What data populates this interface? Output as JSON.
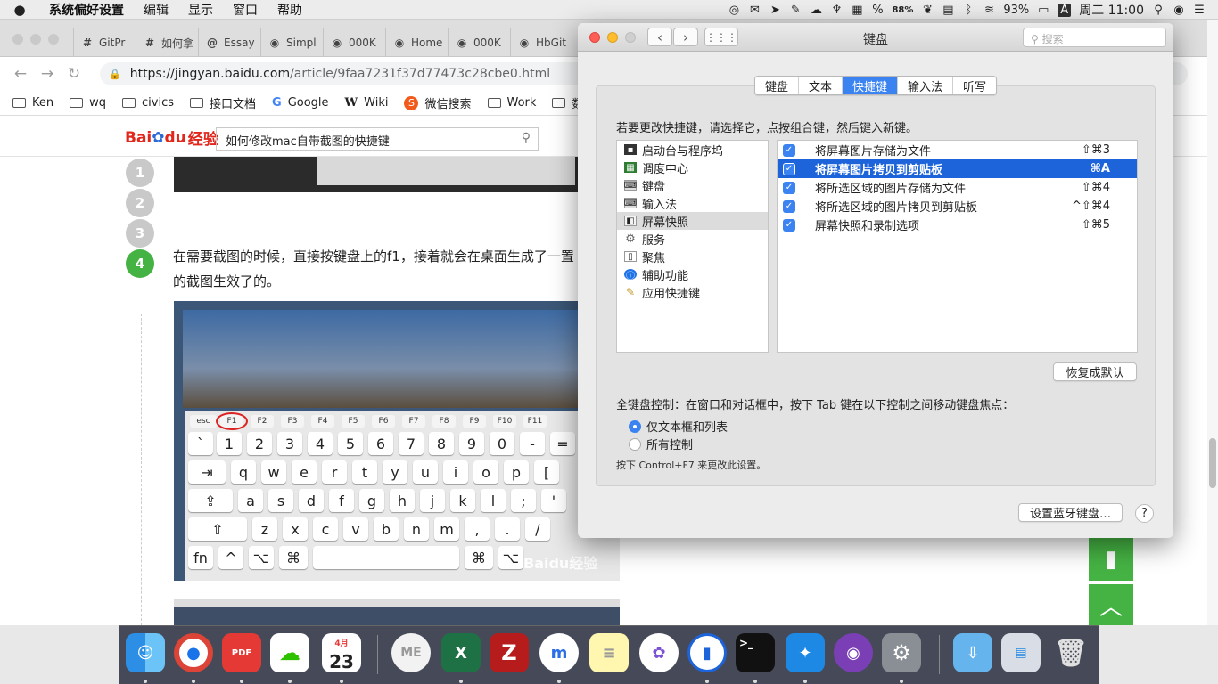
{
  "menubar": {
    "apple": "",
    "app": "系统偏好设置",
    "items": [
      "编辑",
      "显示",
      "窗口",
      "帮助"
    ],
    "battery_small": "88%",
    "battery": "93%",
    "input_method": "A",
    "clock": "周二 11:00"
  },
  "browser": {
    "tabs": [
      {
        "icon": "#",
        "label": "GitPr"
      },
      {
        "icon": "#",
        "label": "如何拿"
      },
      {
        "icon": "@",
        "label": "Essay"
      },
      {
        "icon": "◉",
        "label": "Simpl"
      },
      {
        "icon": "◉",
        "label": "000K"
      },
      {
        "icon": "◉",
        "label": "Home"
      },
      {
        "icon": "◉",
        "label": "000K"
      },
      {
        "icon": "◉",
        "label": "HbGit"
      }
    ],
    "url_main": "https://jingyan.baidu.com",
    "url_path": "/article/9faa7231f37d77473c28cbe0.html",
    "bookmarks": [
      {
        "icon": "folder",
        "label": "Ken"
      },
      {
        "icon": "folder",
        "label": "wq"
      },
      {
        "icon": "folder",
        "label": "civics"
      },
      {
        "icon": "folder",
        "label": "接口文档"
      },
      {
        "icon": "G",
        "label": "Google"
      },
      {
        "icon": "W",
        "label": "Wiki"
      },
      {
        "icon": "S",
        "label": "微信搜索"
      },
      {
        "icon": "folder",
        "label": "Work"
      },
      {
        "icon": "folder",
        "label": "数据"
      }
    ]
  },
  "baidu": {
    "logo_a": "Bai",
    "logo_b": "du",
    "logo_c": "经验",
    "search_value": "如何修改mac自带截图的快捷键"
  },
  "article": {
    "steps": [
      "1",
      "2",
      "3",
      "4"
    ],
    "paragraph": "在需要截图的时候，直接按键盘上的f1，接着就会在桌面生成了一置的截图生效了的。",
    "watermark": "Baidu经验"
  },
  "prefs": {
    "title": "键盘",
    "search_placeholder": "搜索",
    "tabs": [
      "键盘",
      "文本",
      "快捷键",
      "输入法",
      "听写"
    ],
    "selected_tab": "快捷键",
    "instruction": "若要更改快捷键，请选择它，点按组合键，然后键入新键。",
    "categories": [
      {
        "icon": "launchpad-icon",
        "label": "启动台与程序坞"
      },
      {
        "icon": "mission-control-icon",
        "label": "调度中心"
      },
      {
        "icon": "keyboard-icon",
        "label": "键盘"
      },
      {
        "icon": "input-source-icon",
        "label": "输入法"
      },
      {
        "icon": "screenshot-icon",
        "label": "屏幕快照"
      },
      {
        "icon": "services-icon",
        "label": "服务"
      },
      {
        "icon": "spotlight-icon",
        "label": "聚焦"
      },
      {
        "icon": "accessibility-icon",
        "label": "辅助功能"
      },
      {
        "icon": "app-shortcuts-icon",
        "label": "应用快捷键"
      }
    ],
    "selected_category": "屏幕快照",
    "shortcuts": [
      {
        "label": "将屏幕图片存储为文件",
        "shortcut": "⇧⌘3",
        "checked": true
      },
      {
        "label": "将屏幕图片拷贝到剪贴板",
        "shortcut": "⌘A",
        "checked": true
      },
      {
        "label": "将所选区域的图片存储为文件",
        "shortcut": "⇧⌘4",
        "checked": true
      },
      {
        "label": "将所选区域的图片拷贝到剪贴板",
        "shortcut": "^⇧⌘4",
        "checked": true
      },
      {
        "label": "屏幕快照和录制选项",
        "shortcut": "⇧⌘5",
        "checked": true
      }
    ],
    "selected_shortcut": "将屏幕图片拷贝到剪贴板",
    "restore_button": "恢复成默认",
    "full_keyboard_label": "全键盘控制：在窗口和对话框中，按下 Tab 键在以下控制之间移动键盘焦点：",
    "radio_options": [
      "仅文本框和列表",
      "所有控制"
    ],
    "radio_selected": "仅文本框和列表",
    "hint": "按下 Control+F7 来更改此设置。",
    "bluetooth_button": "设置蓝牙键盘…",
    "help_button": "?"
  },
  "dock": {
    "calendar_month": "4月",
    "calendar_day": "23",
    "items": [
      "finder",
      "chrome",
      "pdf",
      "wechat",
      "calendar",
      "ime",
      "excel",
      "filezilla",
      "mindnode",
      "notes",
      "bear",
      "1password",
      "terminal",
      "xcode",
      "github",
      "system-preferences",
      "downloads",
      "screenshot-stack",
      "trash"
    ]
  },
  "colors": {
    "accent": "#3a83f1",
    "selection": "#1d63d9",
    "baidu_green": "#45b343",
    "baidu_red": "#e1261c"
  }
}
